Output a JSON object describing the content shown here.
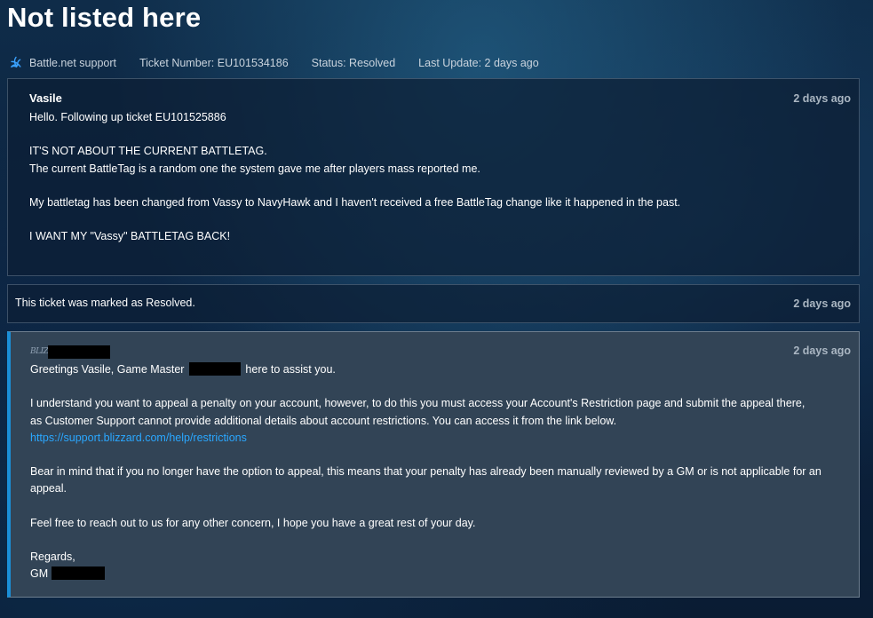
{
  "page": {
    "title": "Not listed here"
  },
  "meta": {
    "icon": "battlenet-icon",
    "support_label": "Battle.net support",
    "ticket_number": "Ticket Number: EU101534186",
    "status": "Status: Resolved",
    "last_update": "Last Update: 2 days ago"
  },
  "messages": [
    {
      "author": "Vasile",
      "time": "2 days ago",
      "lines": [
        "Hello. Following up ticket EU101525886",
        "IT'S NOT ABOUT THE CURRENT BATTLETAG.",
        "The current BattleTag is a random one the system gave me after players mass reported me.",
        "My battletag has been changed from Vassy to NavyHawk and I haven't received a free BattleTag change like it happened in the past.",
        "I WANT MY \"Vassy\" BATTLETAG BACK!"
      ]
    }
  ],
  "notice": {
    "text": "This ticket was marked as Resolved.",
    "time": "2 days ago"
  },
  "gm_reply": {
    "logo_text": "BLIZZ",
    "time": "2 days ago",
    "greeting_pre": "Greetings Vasile, Game Master",
    "greeting_post": "here to assist you.",
    "para1_line1": "I understand you want to appeal a penalty on your account, however, to do this you must access your Account's Restriction page and submit the appeal there,",
    "para1_line2": "as Customer Support cannot provide additional details about account restrictions. You can access it from the link below.",
    "link": "https://support.blizzard.com/help/restrictions",
    "para2": "Bear in mind that if you no longer have the option to appeal, this means that your penalty has already been manually reviewed by a GM or is not applicable for an appeal.",
    "para3": "Feel free to reach out to us for any other concern, I hope you have a great rest of your day.",
    "regards": "Regards,",
    "sign_prefix": "GM"
  },
  "colors": {
    "accent": "#1a8fd8",
    "link": "#2aa7ff",
    "gm_card_bg": "#324456"
  }
}
